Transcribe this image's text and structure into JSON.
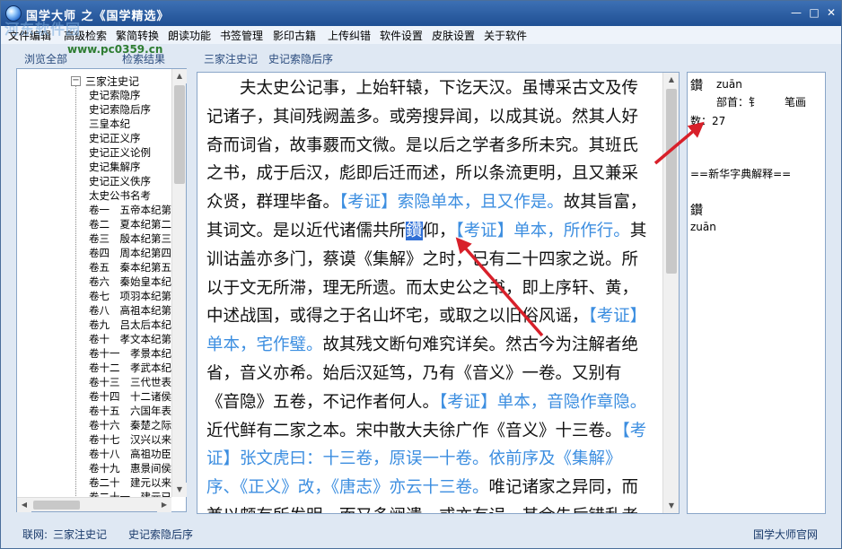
{
  "window": {
    "title": "国学大师 之《国学精选》",
    "min_label": "—",
    "max_label": "□",
    "close_label": "✕"
  },
  "watermark": {
    "text": "河东软件园",
    "url": "www.pc0359.cn"
  },
  "menu": {
    "items": [
      "文件编辑",
      "高级检索",
      "繁简转换",
      "朗读功能",
      "书签管理",
      "影印古籍",
      "上传纠错",
      "软件设置",
      "皮肤设置",
      "关于软件"
    ]
  },
  "left_panel": {
    "tabs": [
      "浏览全部",
      "检索结果"
    ]
  },
  "tree": {
    "toggle_symbol": "−",
    "root": "三家注史记",
    "items": [
      "史记索隐序",
      "史记索隐后序",
      "三皇本纪",
      "史记正义序",
      "史记正义论例",
      "史记集解序",
      "史记正义佚序",
      "太史公书名考",
      "卷一　五帝本纪第一",
      "卷二　夏本纪第二",
      "卷三　殷本纪第三",
      "卷四　周本纪第四",
      "卷五　秦本纪第五",
      "卷六　秦始皇本纪第六",
      "卷七　项羽本纪第七",
      "卷八　高祖本纪第八",
      "卷九　吕太后本纪第九",
      "卷十　孝文本纪第十",
      "卷十一　孝景本纪",
      "卷十二　孝武本纪",
      "卷十三　三代世表",
      "卷十四　十二诸侯年表",
      "卷十五　六国年表",
      "卷十六　秦楚之际月表",
      "卷十七　汉兴以来诸侯王年表",
      "卷十八　高祖功臣侯者年表",
      "卷十九　惠景间侯者年表",
      "卷二十　建元以来侯者年表",
      "卷二十一　建元已来王子侯者年表"
    ]
  },
  "breadcrumb": {
    "book": "三家注史记",
    "chapter": "史记索隐后序"
  },
  "content": {
    "s1": "夫太史公记事，上始轩辕，下讫天汉。虽博采古文及传记诸子，其间残阙盖多。或旁搜异闻，以成其说。然其人好奇而词省，故事覈而文微。是以后之学者多所未究。其班氏之书，成于后汉，彪即后迁而述，所以条流更明，且又兼采众贤，群理毕备。",
    "k1": "【考证】索隐单本，且又作是。",
    "s2": "故其旨富，其词文。是以近代诸儒共所",
    "selected": "鑽",
    "s3": "仰，",
    "k2": "【考证】单本，所作行。",
    "s4": "其训诂盖亦多门，蔡谟《集解》之时，已有二十四家之说。所以于文无所滞，理无所遗。而太史公之书，即上序轩、黄，中述战国，或得之于名山坏宅，或取之以旧俗风谣，",
    "k3": "【考证】单本，宅作璧。",
    "s5": "故其残文断句难究详矣。然古今为注解者绝省，音义亦希。始后汉延笃，乃有《音义》一卷。又别有《音隐》五卷，不记作者何人。",
    "k4": "【考证】单本，音隐作章隐。",
    "s6": "近代鲜有二家之本。宋中散大夫徐广作《音义》十三卷。",
    "k5": "【考证】张文虎曰：十三卷，原误一十卷。依前序及《集解》序、《正义》改，《唐志》亦云十三卷。",
    "s7": "唯记诸家之异同，而兼以颇有所发明，而又多阙遗，或亦有误，其余先后错乱者多。"
  },
  "dictionary": {
    "char": "鑽",
    "pinyin": "zuān",
    "radical": "部首：钅",
    "strokes_label": "笔画",
    "strokes_line": "数：27",
    "section_title": "==新华字典解释==",
    "entry_char": "鑽",
    "entry_pinyin": "zuān"
  },
  "status": {
    "online_label": "联网:",
    "book": "三家注史记",
    "chapter": "史记索隐后序",
    "site": "国学大师官网"
  },
  "colors": {
    "kaozheng": "#3c8ee0",
    "selection": "#2f6fd6",
    "arrow": "#d8202a",
    "titlebar": "#2c5ea3"
  }
}
